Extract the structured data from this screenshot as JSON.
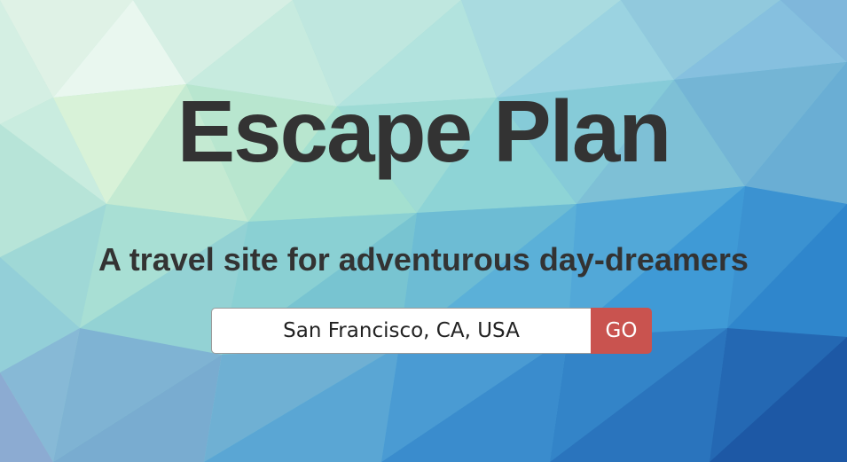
{
  "hero": {
    "title": "Escape Plan",
    "subtitle": "A travel site for adventurous day-dreamers",
    "background": "low-poly-gradient-background",
    "colors": {
      "text": "#333333",
      "accent_button": "#c9534f",
      "bg_top_left": "#eaf7ec",
      "bg_bottom_right": "#1f5fa8"
    }
  },
  "search": {
    "value": "San Francisco, CA, USA",
    "button_label": "GO"
  }
}
